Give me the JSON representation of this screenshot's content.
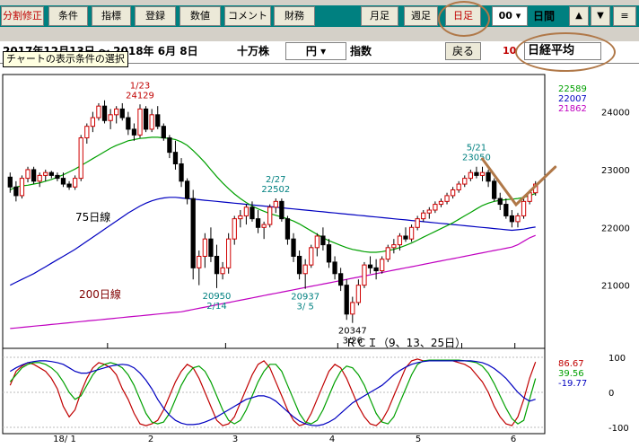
{
  "toolbar": {
    "buttons": [
      "分割修正",
      "条件",
      "指標",
      "登録",
      "数値",
      "コメント",
      "財務"
    ],
    "period_buttons": [
      "月足",
      "週足",
      "日足"
    ],
    "hour_value": "00",
    "hour_unit": "日間",
    "up_arrow": "▲",
    "down_arrow": "▼",
    "menu_icon": "≡"
  },
  "range": {
    "text": "2017年12月13日 ～ 2018年 6月 8日",
    "unit_select": "十万株",
    "currency_select": "円",
    "type_label": "指数",
    "back_button": "戻る",
    "count": "10",
    "name": "日経平均"
  },
  "tooltip": "チャートの表示条件の選択",
  "chart_data": [
    {
      "type": "candlestick",
      "ylim": [
        20000,
        24600
      ],
      "yticks": [
        21000,
        22000,
        23000,
        24000
      ],
      "xtick_labels": [
        "18/ 1",
        "2",
        "3",
        "4",
        "5",
        "6"
      ],
      "legend_values": [
        {
          "value": "22589",
          "color": "#00a000"
        },
        {
          "value": "22007",
          "color": "#0000c0"
        },
        {
          "value": "21862",
          "color": "#c000c0"
        }
      ],
      "ma_labels": [
        {
          "text": "75日線",
          "color": "#000000"
        },
        {
          "text": "200日線",
          "color": "#800000"
        }
      ],
      "annotations": [
        {
          "date": "1/23",
          "value": "24129",
          "color": "#c00000",
          "kind": "high"
        },
        {
          "date": "2/27",
          "value": "22502",
          "color": "#008080",
          "kind": "high"
        },
        {
          "date": "2/14",
          "value": "20950",
          "color": "#008080",
          "kind": "low"
        },
        {
          "date": "3/ 5",
          "value": "20937",
          "color": "#008080",
          "kind": "low"
        },
        {
          "date": "3/26",
          "value": "20347",
          "color": "#000000",
          "kind": "low"
        },
        {
          "date": "5/21",
          "value": "23050",
          "color": "#008080",
          "kind": "high"
        }
      ],
      "ohlc": [
        [
          22870,
          22950,
          22600,
          22700
        ],
        [
          22700,
          22800,
          22450,
          22550
        ],
        [
          22550,
          22900,
          22500,
          22850
        ],
        [
          22850,
          23050,
          22780,
          23000
        ],
        [
          23000,
          23050,
          22750,
          22800
        ],
        [
          22800,
          22950,
          22700,
          22900
        ],
        [
          22900,
          23000,
          22800,
          22950
        ],
        [
          22950,
          22980,
          22850,
          22900
        ],
        [
          22900,
          22950,
          22800,
          22850
        ],
        [
          22850,
          22950,
          22700,
          22750
        ],
        [
          22750,
          22800,
          22650,
          22700
        ],
        [
          22700,
          22900,
          22650,
          22850
        ],
        [
          22850,
          23600,
          22800,
          23550
        ],
        [
          23550,
          23800,
          23450,
          23750
        ],
        [
          23750,
          24000,
          23650,
          23900
        ],
        [
          23900,
          24150,
          23850,
          24100
        ],
        [
          24100,
          24200,
          23800,
          23850
        ],
        [
          23850,
          24050,
          23700,
          23950
        ],
        [
          23950,
          24100,
          23800,
          24050
        ],
        [
          24050,
          24150,
          23850,
          23900
        ],
        [
          23900,
          24000,
          23600,
          23700
        ],
        [
          23700,
          23800,
          23500,
          23600
        ],
        [
          23600,
          24129,
          23550,
          24050
        ],
        [
          24050,
          24100,
          23650,
          23700
        ],
        [
          23700,
          24050,
          23650,
          23950
        ],
        [
          23950,
          24100,
          23700,
          23750
        ],
        [
          23750,
          23800,
          23500,
          23550
        ],
        [
          23550,
          23600,
          23200,
          23300
        ],
        [
          23300,
          23500,
          23000,
          23100
        ],
        [
          23100,
          23200,
          22700,
          22800
        ],
        [
          22800,
          22850,
          22400,
          22500
        ],
        [
          22500,
          22650,
          21100,
          21300
        ],
        [
          21300,
          21600,
          21000,
          21500
        ],
        [
          21500,
          21900,
          21300,
          21800
        ],
        [
          21800,
          22000,
          21400,
          21500
        ],
        [
          21500,
          21700,
          20950,
          21200
        ],
        [
          21200,
          21400,
          21100,
          21300
        ],
        [
          21300,
          21900,
          21200,
          21800
        ],
        [
          21800,
          22200,
          21700,
          22150
        ],
        [
          22150,
          22300,
          22000,
          22200
        ],
        [
          22200,
          22400,
          22050,
          22350
        ],
        [
          22350,
          22450,
          22100,
          22150
        ],
        [
          22150,
          22300,
          21900,
          22000
        ],
        [
          22000,
          22100,
          21800,
          22050
        ],
        [
          22050,
          22400,
          22000,
          22350
        ],
        [
          22350,
          22502,
          22250,
          22450
        ],
        [
          22450,
          22500,
          22100,
          22150
        ],
        [
          22150,
          22200,
          21700,
          21800
        ],
        [
          21800,
          21900,
          21400,
          21500
        ],
        [
          21500,
          21600,
          21100,
          21200
        ],
        [
          21200,
          21450,
          20937,
          21350
        ],
        [
          21350,
          21700,
          21300,
          21650
        ],
        [
          21650,
          21900,
          21500,
          21850
        ],
        [
          21850,
          22000,
          21600,
          21700
        ],
        [
          21700,
          21800,
          21300,
          21400
        ],
        [
          21400,
          21500,
          21100,
          21200
        ],
        [
          21200,
          21300,
          20900,
          21000
        ],
        [
          21000,
          21100,
          20400,
          20500
        ],
        [
          20500,
          20800,
          20347,
          20700
        ],
        [
          20700,
          21100,
          20650,
          21000
        ],
        [
          21000,
          21400,
          20950,
          21350
        ],
        [
          21350,
          21500,
          21200,
          21300
        ],
        [
          21300,
          21450,
          21100,
          21250
        ],
        [
          21250,
          21500,
          21200,
          21450
        ],
        [
          21450,
          21700,
          21400,
          21650
        ],
        [
          21650,
          21800,
          21550,
          21700
        ],
        [
          21700,
          21900,
          21600,
          21850
        ],
        [
          21850,
          22000,
          21750,
          21800
        ],
        [
          21800,
          22050,
          21750,
          22000
        ],
        [
          22000,
          22200,
          21950,
          22150
        ],
        [
          22150,
          22300,
          22100,
          22250
        ],
        [
          22250,
          22350,
          22150,
          22300
        ],
        [
          22300,
          22450,
          22250,
          22400
        ],
        [
          22400,
          22500,
          22350,
          22450
        ],
        [
          22450,
          22600,
          22400,
          22550
        ],
        [
          22550,
          22700,
          22500,
          22650
        ],
        [
          22650,
          22800,
          22600,
          22750
        ],
        [
          22750,
          22900,
          22700,
          22850
        ],
        [
          22850,
          23000,
          22800,
          22950
        ],
        [
          22950,
          23050,
          22850,
          22900
        ],
        [
          22900,
          23050,
          22800,
          22950
        ],
        [
          22950,
          23000,
          22700,
          22800
        ],
        [
          22800,
          22850,
          22450,
          22500
        ],
        [
          22500,
          22600,
          22300,
          22400
        ],
        [
          22400,
          22500,
          22150,
          22200
        ],
        [
          22200,
          22300,
          22000,
          22100
        ],
        [
          22100,
          22250,
          22000,
          22200
        ],
        [
          22200,
          22500,
          22150,
          22450
        ],
        [
          22450,
          22650,
          22400,
          22600
        ],
        [
          22600,
          22800,
          22550,
          22750
        ]
      ],
      "ma25": [
        22650,
        22700,
        22720,
        22730,
        22750,
        22770,
        22800,
        22830,
        22870,
        22910,
        22960,
        23010,
        23070,
        23130,
        23190,
        23250,
        23310,
        23370,
        23420,
        23460,
        23500,
        23520,
        23540,
        23550,
        23560,
        23560,
        23550,
        23540,
        23520,
        23480,
        23420,
        23330,
        23230,
        23120,
        23000,
        22880,
        22770,
        22670,
        22580,
        22500,
        22430,
        22370,
        22320,
        22280,
        22240,
        22210,
        22180,
        22150,
        22110,
        22060,
        22000,
        21940,
        21880,
        21820,
        21770,
        21730,
        21690,
        21650,
        21620,
        21600,
        21580,
        21570,
        21570,
        21580,
        21600,
        21620,
        21650,
        21690,
        21730,
        21780,
        21830,
        21880,
        21930,
        21980,
        22030,
        22080,
        22140,
        22200,
        22260,
        22320,
        22380,
        22420,
        22450,
        22470,
        22480,
        22490,
        22500,
        22520,
        22550,
        22589
      ],
      "ma75": [
        21000,
        21050,
        21100,
        21150,
        21200,
        21260,
        21320,
        21380,
        21440,
        21500,
        21560,
        21620,
        21690,
        21760,
        21830,
        21900,
        21970,
        22040,
        22110,
        22180,
        22250,
        22310,
        22370,
        22420,
        22460,
        22490,
        22510,
        22520,
        22520,
        22510,
        22500,
        22490,
        22480,
        22470,
        22460,
        22450,
        22440,
        22430,
        22420,
        22410,
        22400,
        22390,
        22380,
        22370,
        22360,
        22350,
        22340,
        22330,
        22320,
        22310,
        22300,
        22290,
        22280,
        22270,
        22260,
        22250,
        22240,
        22230,
        22220,
        22210,
        22200,
        22190,
        22180,
        22170,
        22160,
        22150,
        22140,
        22130,
        22120,
        22110,
        22100,
        22090,
        22080,
        22070,
        22060,
        22050,
        22040,
        22030,
        22020,
        22010,
        22000,
        21990,
        21980,
        21970,
        21960,
        21950,
        21960,
        21970,
        21990,
        22007
      ],
      "ma200": [
        20250,
        20260,
        20270,
        20280,
        20290,
        20300,
        20310,
        20320,
        20330,
        20340,
        20350,
        20360,
        20370,
        20380,
        20390,
        20400,
        20410,
        20420,
        20430,
        20440,
        20450,
        20460,
        20470,
        20480,
        20490,
        20500,
        20510,
        20520,
        20530,
        20540,
        20560,
        20580,
        20600,
        20620,
        20640,
        20660,
        20680,
        20700,
        20720,
        20740,
        20760,
        20780,
        20800,
        20820,
        20840,
        20860,
        20880,
        20900,
        20920,
        20940,
        20960,
        20980,
        21000,
        21020,
        21040,
        21060,
        21080,
        21100,
        21120,
        21140,
        21160,
        21180,
        21200,
        21220,
        21240,
        21260,
        21280,
        21300,
        21320,
        21340,
        21360,
        21380,
        21400,
        21420,
        21440,
        21460,
        21480,
        21500,
        21520,
        21540,
        21560,
        21580,
        21600,
        21620,
        21640,
        21660,
        21700,
        21760,
        21820,
        21862
      ]
    },
    {
      "type": "line",
      "title": "ＲＣＩ（9、13、25日）",
      "ylim": [
        -100,
        100
      ],
      "yticks": [
        100,
        0,
        -100
      ],
      "legend_values": [
        {
          "value": "86.67",
          "color": "#c00000"
        },
        {
          "value": "39.56",
          "color": "#00a000"
        },
        {
          "value": "-19.77",
          "color": "#0000c0"
        }
      ],
      "series": [
        {
          "color": "#c00000",
          "values": [
            20,
            60,
            75,
            85,
            80,
            70,
            60,
            40,
            10,
            -40,
            -70,
            -50,
            0,
            40,
            70,
            85,
            80,
            70,
            50,
            10,
            -20,
            -60,
            -90,
            -95,
            -90,
            -80,
            -50,
            -10,
            30,
            60,
            80,
            70,
            40,
            0,
            -40,
            -80,
            -95,
            -90,
            -70,
            -30,
            10,
            50,
            80,
            90,
            70,
            30,
            -10,
            -50,
            -80,
            -95,
            -90,
            -60,
            -20,
            20,
            60,
            80,
            70,
            40,
            0,
            -40,
            -70,
            -90,
            -95,
            -80,
            -50,
            -10,
            30,
            70,
            90,
            95,
            90,
            90,
            90,
            90,
            90,
            90,
            85,
            80,
            70,
            50,
            30,
            0,
            -40,
            -70,
            -90,
            -95,
            -70,
            -20,
            40,
            86.67
          ]
        },
        {
          "color": "#00a000",
          "values": [
            30,
            50,
            70,
            80,
            85,
            85,
            80,
            70,
            55,
            30,
            0,
            -20,
            -10,
            20,
            50,
            70,
            80,
            85,
            80,
            70,
            50,
            20,
            -20,
            -60,
            -85,
            -90,
            -85,
            -60,
            -20,
            20,
            50,
            70,
            75,
            60,
            30,
            -10,
            -50,
            -80,
            -90,
            -80,
            -50,
            -10,
            30,
            60,
            80,
            80,
            60,
            20,
            -20,
            -60,
            -85,
            -90,
            -80,
            -50,
            -10,
            30,
            60,
            75,
            70,
            50,
            20,
            -20,
            -60,
            -85,
            -90,
            -70,
            -30,
            10,
            50,
            80,
            90,
            92,
            92,
            92,
            92,
            92,
            92,
            90,
            88,
            85,
            75,
            55,
            25,
            -10,
            -45,
            -75,
            -90,
            -80,
            -20,
            39.56
          ]
        },
        {
          "color": "#0000c0",
          "values": [
            60,
            70,
            78,
            85,
            88,
            90,
            90,
            88,
            85,
            80,
            70,
            60,
            55,
            55,
            60,
            65,
            70,
            75,
            78,
            80,
            78,
            70,
            55,
            35,
            10,
            -20,
            -45,
            -65,
            -80,
            -88,
            -92,
            -92,
            -90,
            -85,
            -78,
            -70,
            -60,
            -50,
            -40,
            -30,
            -20,
            -15,
            -10,
            -10,
            -15,
            -25,
            -40,
            -55,
            -70,
            -82,
            -90,
            -94,
            -95,
            -92,
            -85,
            -75,
            -60,
            -45,
            -30,
            -20,
            -10,
            0,
            10,
            20,
            35,
            50,
            62,
            72,
            80,
            85,
            88,
            90,
            90,
            90,
            90,
            90,
            90,
            90,
            90,
            88,
            85,
            78,
            68,
            55,
            40,
            20,
            0,
            -15,
            -25,
            -19.77
          ]
        }
      ]
    }
  ]
}
